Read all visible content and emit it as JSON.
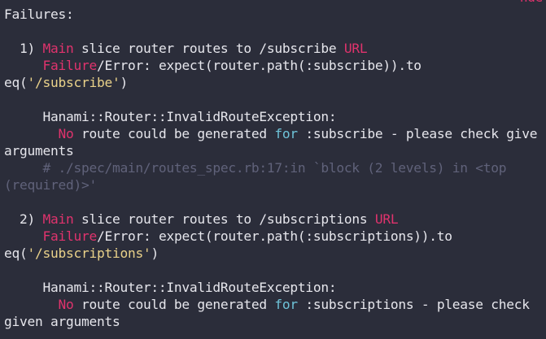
{
  "terminal": {
    "corner_fragment": "nde",
    "header": "Failures:",
    "failures": [
      {
        "number": "1)",
        "context": "Main",
        "description": "slice router routes to /subscribe",
        "suffix": "URL",
        "failure_word": "Failure",
        "error_label": "/Error:",
        "expectation": "expect(router.path(:subscribe)).to",
        "eq_open": "eq(",
        "eq_value": "'/subscribe'",
        "eq_close": ")",
        "exception": "Hanami::Router::InvalidRouteException:",
        "msg_no": "No",
        "msg_middle": "route could be generated",
        "msg_for": "for",
        "msg_rest": ":subscribe - please check give",
        "msg_wrap": "arguments",
        "backtrace_1": "# ./spec/main/routes_spec.rb:17:in `block (2 levels) in <top",
        "backtrace_2": "(required)>'"
      },
      {
        "number": "2)",
        "context": "Main",
        "description": "slice router routes to /subscriptions",
        "suffix": "URL",
        "failure_word": "Failure",
        "error_label": "/Error:",
        "expectation": "expect(router.path(:subscriptions)).to",
        "eq_open": "eq(",
        "eq_value": "'/subscriptions'",
        "eq_close": ")",
        "exception": "Hanami::Router::InvalidRouteException:",
        "msg_no": "No",
        "msg_middle": "route could be generated",
        "msg_for": "for",
        "msg_rest": ":subscriptions - please check",
        "msg_wrap": "given arguments"
      }
    ]
  },
  "colors": {
    "background": "#2b2d3a",
    "foreground": "#e6e6ec",
    "red": "#e0336d",
    "cyan": "#6ec3d8",
    "yellow": "#ead28a",
    "comment": "#60627a"
  }
}
